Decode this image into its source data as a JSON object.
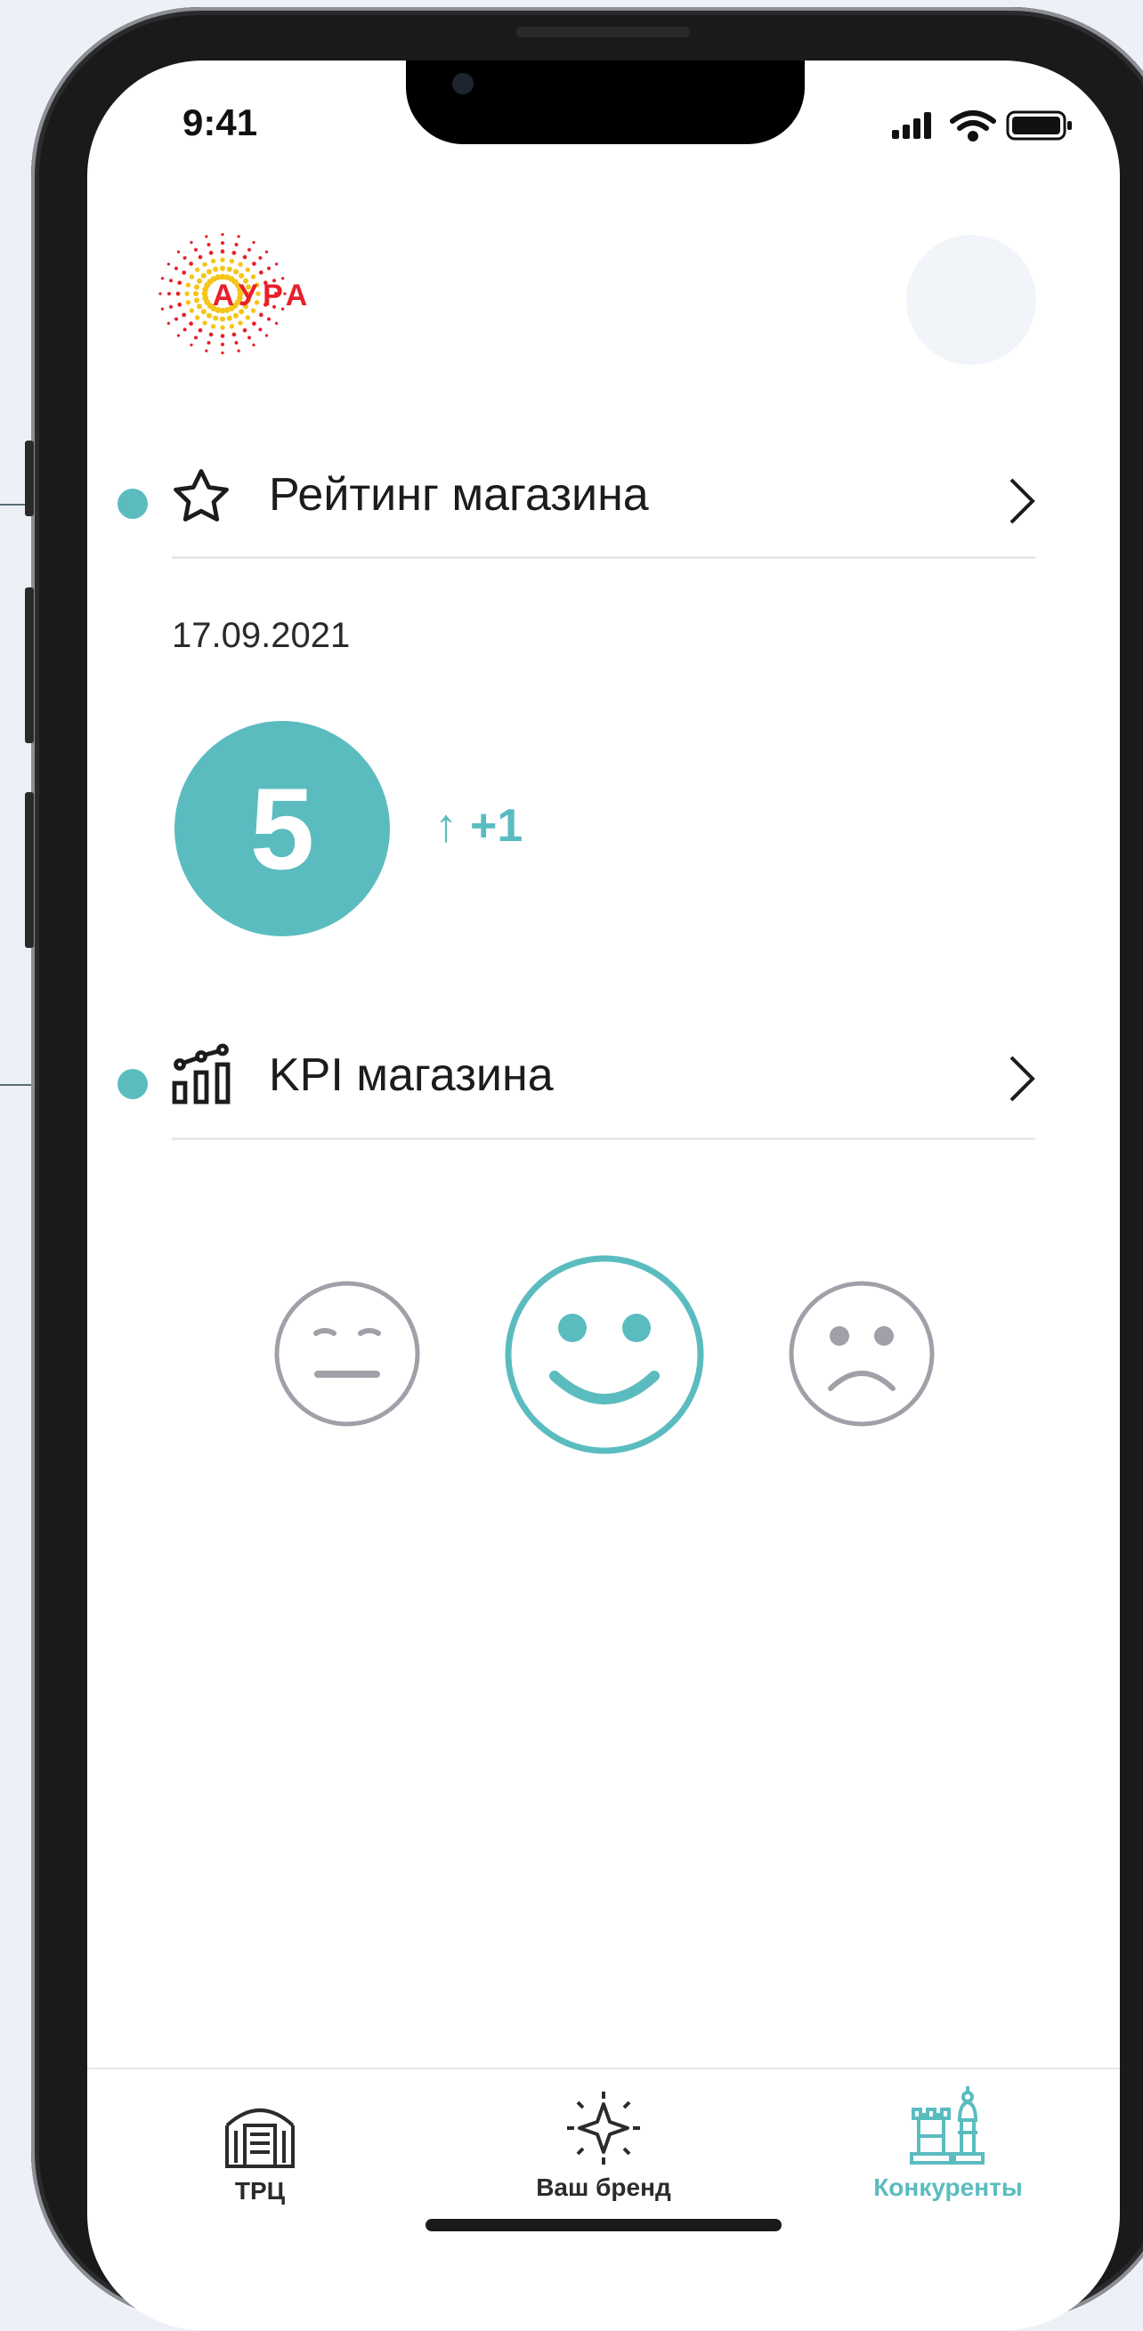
{
  "status_bar": {
    "time": "9:41"
  },
  "app": {
    "logo_text": "АУРА"
  },
  "rating_row": {
    "title": "Рейтинг магазина"
  },
  "rating": {
    "date": "17.09.2021",
    "value": "5",
    "trend_arrow": "↑",
    "trend": "+1"
  },
  "kpi_row": {
    "title": "KPI магазина"
  },
  "mood": {
    "options": [
      "neutral",
      "happy",
      "sad"
    ],
    "selected": "happy"
  },
  "tabs": [
    {
      "label": "ТРЦ",
      "icon": "mall-icon",
      "active": false
    },
    {
      "label": "Ваш бренд",
      "icon": "sparkle-icon",
      "active": false
    },
    {
      "label": "Конкуренты",
      "icon": "chess-icon",
      "active": true
    }
  ],
  "colors": {
    "accent": "#5bbcc0",
    "inactive": "#a0a0a8",
    "text": "#1c1c1c"
  }
}
